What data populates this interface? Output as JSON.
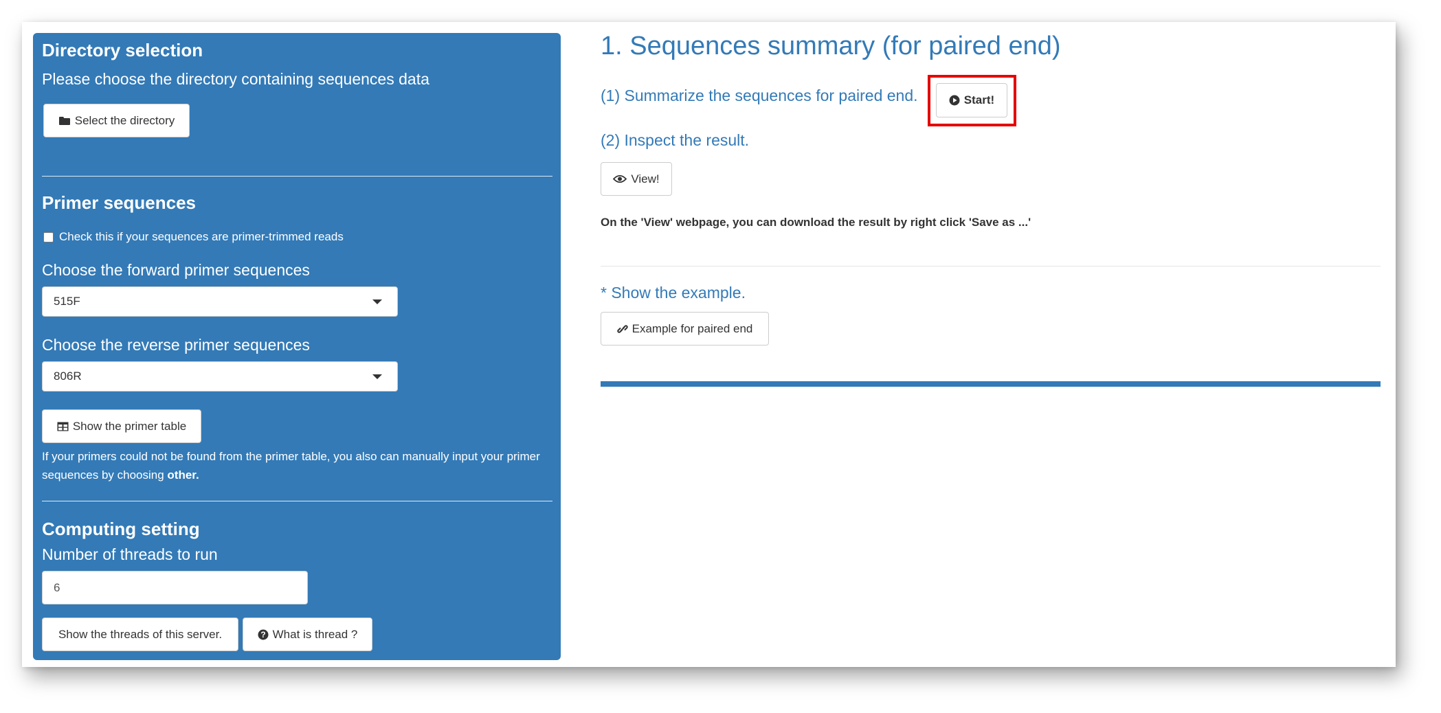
{
  "sidebar": {
    "directory": {
      "title": "Directory selection",
      "label": "Please choose the directory containing sequences data",
      "button": "Select the directory",
      "button_icon": "folder-icon"
    },
    "primer": {
      "title": "Primer sequences",
      "checkbox_label": "Check this if your sequences are primer-trimmed reads",
      "checkbox_checked": false,
      "forward_label": "Choose the forward primer sequences",
      "forward_value": "515F",
      "reverse_label": "Choose the reverse primer sequences",
      "reverse_value": "806R",
      "table_button": "Show the primer table",
      "table_button_icon": "table-icon",
      "note": "If your primers could not be found from the primer table, you also can manually input your primer sequences by choosing",
      "note_bold": "other."
    },
    "computing": {
      "title": "Computing setting",
      "threads_label": "Number of threads to run",
      "threads_value": "6",
      "show_threads_button": "Show the threads of this server.",
      "what_thread_button": "What is thread ?",
      "what_thread_icon": "question-circle-icon"
    }
  },
  "main": {
    "title": "1. Sequences summary (for paired end)",
    "step1": "(1) Summarize the sequences for paired end.",
    "start_button": "Start!",
    "start_icon": "play-circle-icon",
    "step2": "(2) Inspect the result.",
    "view_button": "View!",
    "view_icon": "eye-icon",
    "download_note": "On the 'View' webpage, you can download the result by right click 'Save as ...'",
    "example_heading": "* Show the example.",
    "example_button": "Example for paired end",
    "example_icon": "link-icon"
  },
  "colors": {
    "sidebar_bg": "#337ab7",
    "heading_blue": "#337ab7",
    "highlight_red": "#e60000"
  }
}
